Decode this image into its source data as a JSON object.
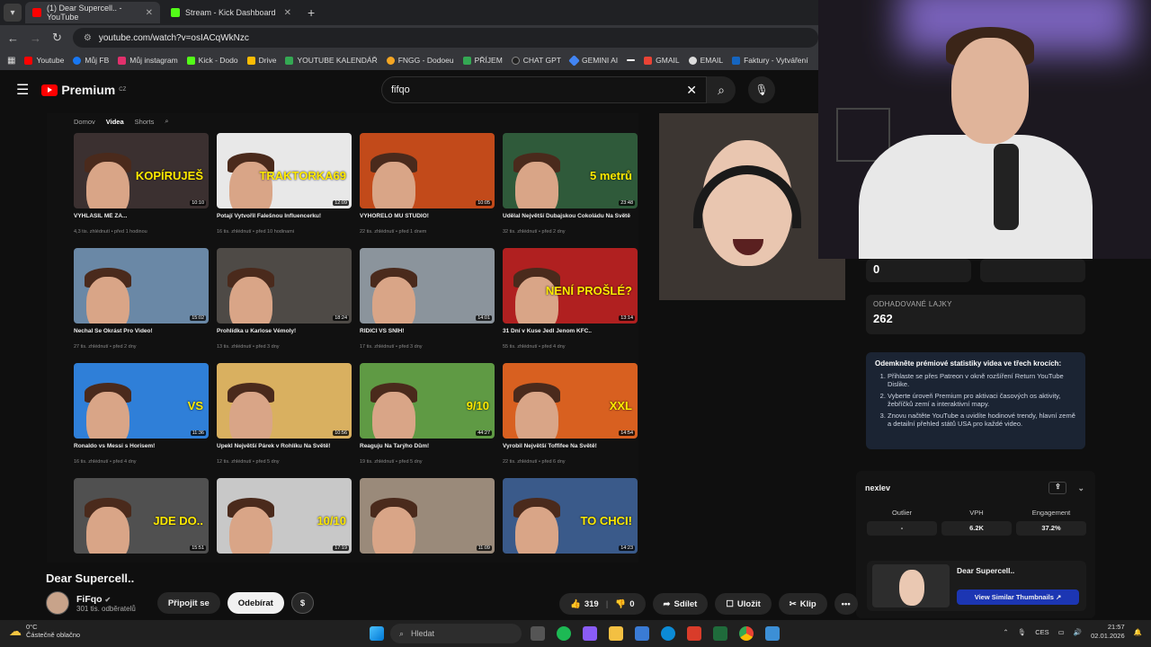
{
  "browser": {
    "tabs": [
      {
        "label": "(1) Dear Supercell.. - YouTube",
        "close": "✕"
      },
      {
        "label": "Stream - Kick Dashboard",
        "close": "✕"
      }
    ],
    "new_tab": "+",
    "url": "youtube.com/watch?v=osIACqWkNzc",
    "bookmarks": [
      {
        "label": "Youtube",
        "color": "#ff0000"
      },
      {
        "label": "Můj FB",
        "color": "#1877f2"
      },
      {
        "label": "Můj instagram",
        "color": "#e1306c"
      },
      {
        "label": "Kick - Dodo",
        "color": "#53fc18"
      },
      {
        "label": "Drive",
        "color": "#fbbc04"
      },
      {
        "label": "YOUTUBE KALENDÁŘ",
        "color": "#34a853"
      },
      {
        "label": "FNGG - Dodoeu",
        "color": "#f5a623"
      },
      {
        "label": "PŘÍJEM",
        "color": "#34a853"
      },
      {
        "label": "CHAT GPT",
        "color": "#222222"
      },
      {
        "label": "GEMINI AI",
        "color": "#4285f4"
      },
      {
        "label": "",
        "color": "#ffffff"
      },
      {
        "label": "GMAIL",
        "color": "#ea4335"
      },
      {
        "label": "EMAIL",
        "color": "#dddddd"
      },
      {
        "label": "Faktury - Vytváření",
        "color": "#1565c0"
      }
    ]
  },
  "youtube": {
    "logo": "Premium",
    "logo_sup": "CZ",
    "search_value": "fifqo",
    "channel_nav": [
      "Domov",
      "Videa",
      "Shorts"
    ],
    "videos": [
      {
        "title": "VYHLÁSIL MĚ ZA...",
        "meta": "4,3 tis. zhlédnutí • před 1 hodinou",
        "dur": "10:10",
        "overlay": "KOPÍRUJEŠ",
        "bg": "#3b3030"
      },
      {
        "title": "Potají Vytvořil Falešnou Influencerku!",
        "meta": "16 tis. zhlédnutí • před 10 hodinami",
        "dur": "12:09",
        "overlay": "TRAKTORKA69",
        "bg": "#e8e8e8"
      },
      {
        "title": "VYHOŘELO MU STUDIO!",
        "meta": "22 tis. zhlédnutí • před 1 dnem",
        "dur": "10:05",
        "overlay": "",
        "bg": "#c24a1a"
      },
      {
        "title": "Udělal Největší Dubajskou Čokoládu Na Světě",
        "meta": "32 tis. zhlédnutí • před 2 dny",
        "dur": "23:48",
        "overlay": "5 metrů",
        "bg": "#2f5a3a"
      },
      {
        "title": "Nechal Se Okrást Pro Video!",
        "meta": "27 tis. zhlédnutí • před 2 dny",
        "dur": "15:02",
        "overlay": "",
        "bg": "#6a88a6"
      },
      {
        "title": "Prohlídka u Karlose Vémoly!",
        "meta": "13 tis. zhlédnutí • před 3 dny",
        "dur": "18:24",
        "overlay": "",
        "bg": "#4e4a46"
      },
      {
        "title": "ŘIDIČI VS SNÍH!",
        "meta": "17 tis. zhlédnutí • před 3 dny",
        "dur": "14:01",
        "overlay": "",
        "bg": "#8b949c"
      },
      {
        "title": "31 Dní v Kuse Jedl Jenom KFC..",
        "meta": "55 tis. zhlédnutí • před 4 dny",
        "dur": "13:14",
        "overlay": "NENÍ PROŠLÉ?",
        "bg": "#b02020"
      },
      {
        "title": "Ronaldo vs Messi s Horisem!",
        "meta": "16 tis. zhlédnutí • před 4 dny",
        "dur": "11:36",
        "overlay": "VS",
        "bg": "#2f7fd8"
      },
      {
        "title": "Upekl Největší Párek v Rohlíku Na Světě!",
        "meta": "12 tis. zhlédnutí • před 5 dny",
        "dur": "10:56",
        "overlay": "",
        "bg": "#d9b060"
      },
      {
        "title": "Reaguju Na Tarýho Dům!",
        "meta": "19 tis. zhlédnutí • před 5 dny",
        "dur": "44:27",
        "overlay": "9/10",
        "bg": "#5f9a44"
      },
      {
        "title": "Vyrobil Největší Toffifee Na Světě!",
        "meta": "22 tis. zhlédnutí • před 6 dny",
        "dur": "14:54",
        "overlay": "XXL",
        "bg": "#d86020"
      },
      {
        "title": "",
        "meta": "",
        "dur": "15:51",
        "overlay": "JDE DO..",
        "bg": "#505050"
      },
      {
        "title": "",
        "meta": "",
        "dur": "17:19",
        "overlay": "10/10",
        "bg": "#c8c8c8"
      },
      {
        "title": "",
        "meta": "",
        "dur": "11:09",
        "overlay": "",
        "bg": "#9a8a7a"
      },
      {
        "title": "",
        "meta": "",
        "dur": "14:23",
        "overlay": "TO CHCI!",
        "bg": "#3a5a8a"
      }
    ],
    "video_title": "Dear Supercell..",
    "channel_name": "FiFqo",
    "subscribers": "301 tis. odběratelů",
    "join_label": "Připojit se",
    "subscribe_label": "Odebírat",
    "thanks_label": "$",
    "likes": "319",
    "dislikes": "0",
    "share_label": "Sdílet",
    "save_label": "Uložit",
    "clip_label": "Klip",
    "more_label": "•••"
  },
  "stats_panel": {
    "top_value": "0",
    "likes_label": "ODHADOVANÉ LAJKY",
    "likes_value": "262",
    "unlock_title": "Odemkněte prémiové statistiky videa ve třech krocích:",
    "unlock_steps": [
      "Přihlaste se přes Patreon v okně rozšíření Return YouTube Dislike.",
      "Vyberte úroveň Premium pro aktivaci časových os aktivity, žebříčků zemí a interaktivní mapy.",
      "Znovu načtěte YouTube a uvidíte hodinové trendy, hlavní země a detailní přehled států USA pro každé video."
    ],
    "vidiq_logo": "nexlev",
    "cols": [
      "Outlier",
      "VPH",
      "Engagement"
    ],
    "vals": [
      "-",
      "6.2K",
      "37.2%"
    ],
    "similar_title": "Dear Supercell..",
    "similar_btn": "View Similar Thumbnails ↗"
  },
  "taskbar": {
    "temp": "0°C",
    "weather": "Částečně oblačno",
    "search_placeholder": "Hledat",
    "lang": "CES",
    "time": "21:57",
    "date": "02.01.2026"
  }
}
